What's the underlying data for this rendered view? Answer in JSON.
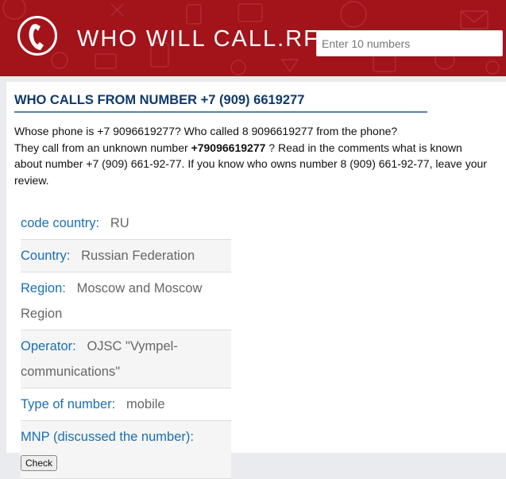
{
  "header": {
    "site_title": "WHO WILL CALL.RF",
    "logo_icon": "phone-handset-icon",
    "search": {
      "placeholder": "Enter 10 numbers",
      "value": ""
    },
    "colors": {
      "background": "#a3131a",
      "text": "#ffffff"
    }
  },
  "main": {
    "title": "WHO CALLS FROM NUMBER +7 (909) 6619277",
    "intro": {
      "line1": "Whose phone is +7 9096619277? Who called 8 9096619277 from the phone?",
      "line2_prefix": "They call from an unknown number ",
      "line2_bold": "+79096619277",
      "line2_suffix": " ? Read in the comments what is known about number +7 (909) 661-92-77. If you know who owns number 8 (909) 661-92-77, leave your review."
    },
    "info": {
      "code_country": {
        "key": "code country:",
        "value": "RU"
      },
      "country": {
        "key": "Country:",
        "value": "Russian Federation"
      },
      "region": {
        "key": "Region:",
        "value": "Moscow and Moscow Region"
      },
      "operator": {
        "key": "Operator:",
        "value": "OJSC \"Vympel-communications\""
      },
      "type": {
        "key": "Type of number:",
        "value": "mobile"
      },
      "mnp": {
        "key": "MNP (discussed the number):",
        "button": "Check"
      }
    },
    "colors": {
      "title": "#103a6a",
      "key": "#1a6fb4",
      "value": "#666666"
    }
  }
}
